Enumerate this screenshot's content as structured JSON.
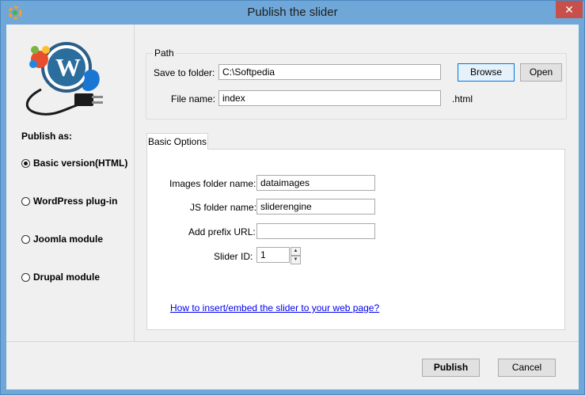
{
  "window": {
    "title": "Publish the slider",
    "close_glyph": "✕"
  },
  "left": {
    "publish_as_label": "Publish as:",
    "options": [
      {
        "label": "Basic version(HTML)",
        "checked": true
      },
      {
        "label": "WordPress plug-in",
        "checked": false
      },
      {
        "label": "Joomla module",
        "checked": false
      },
      {
        "label": "Drupal module",
        "checked": false
      }
    ]
  },
  "path": {
    "group_label": "Path",
    "save_label": "Save to folder:",
    "save_value": "C:\\Softpedia",
    "browse_label": "Browse",
    "open_label": "Open",
    "file_label": "File name:",
    "file_value": "index",
    "extension": ".html"
  },
  "options": {
    "tab_label": "Basic Options",
    "images_label": "Images folder name:",
    "images_value": "dataimages",
    "js_label": "JS folder name:",
    "js_value": "sliderengine",
    "prefix_label": "Add prefix URL:",
    "prefix_value": "",
    "slider_id_label": "Slider ID:",
    "slider_id_value": "1",
    "help_link": "How to insert/embed the slider to your web page?"
  },
  "footer": {
    "publish_label": "Publish",
    "cancel_label": "Cancel"
  },
  "colors": {
    "titlebar": "#6fa7d8",
    "close": "#c7504a",
    "link": "#0000ee"
  }
}
